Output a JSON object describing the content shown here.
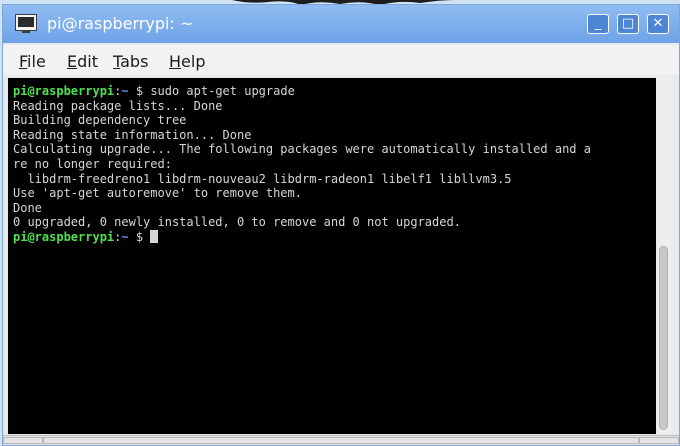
{
  "window": {
    "title": "pi@raspberrypi: ~",
    "buttons": {
      "minimize": "_",
      "maximize": "□",
      "close": "✕"
    }
  },
  "menu": [
    {
      "underline": "F",
      "rest": "ile"
    },
    {
      "underline": "E",
      "rest": "dit"
    },
    {
      "underline": "T",
      "rest": "abs"
    },
    {
      "underline": "H",
      "rest": "elp"
    }
  ],
  "terminal": {
    "prompt": {
      "user": "pi@raspberrypi",
      "sep": ":",
      "path": "~",
      "dollar": " $ "
    },
    "command": "sudo apt-get upgrade",
    "output": [
      "Reading package lists... Done",
      "Building dependency tree",
      "Reading state information... Done",
      "Calculating upgrade... The following packages were automatically installed and a",
      "re no longer required:",
      "  libdrm-freedreno1 libdrm-nouveau2 libdrm-radeon1 libelf1 libllvm3.5",
      "Use 'apt-get autoremove' to remove them.",
      "Done",
      "0 upgraded, 0 newly installed, 0 to remove and 0 not upgraded."
    ]
  },
  "colors": {
    "titlebar": "#7aaeed",
    "terminal_bg": "#000000",
    "prompt_user": "#4fe04f",
    "prompt_path": "#5a8fe6",
    "text": "#d6d6d6"
  },
  "icons": {
    "window": "terminal-icon"
  }
}
